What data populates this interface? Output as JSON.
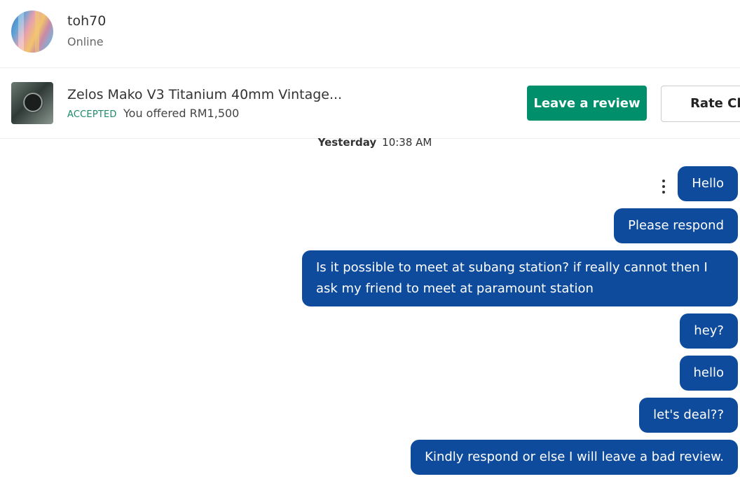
{
  "header": {
    "username": "toh70",
    "status": "Online"
  },
  "listing": {
    "title": "Zelos Mako V3 Titanium 40mm Vintage...",
    "badge": "ACCEPTED",
    "offer": "You offered RM1,500",
    "review_button": "Leave a review",
    "rate_button": "Rate Chat"
  },
  "timestamp": {
    "day": "Yesterday",
    "time": "10:38 AM"
  },
  "messages": [
    {
      "text": "Hello"
    },
    {
      "text": "Please respond"
    },
    {
      "text": "Is it possible to meet at subang station? if really cannot then I ask my friend to meet at paramount station"
    },
    {
      "text": "hey?"
    },
    {
      "text": "hello"
    },
    {
      "text": "let's deal??"
    },
    {
      "text": "Kindly respond or else I will leave a bad review."
    }
  ],
  "colors": {
    "accent_green": "#008f6b",
    "bubble_blue": "#0e4b9c"
  }
}
